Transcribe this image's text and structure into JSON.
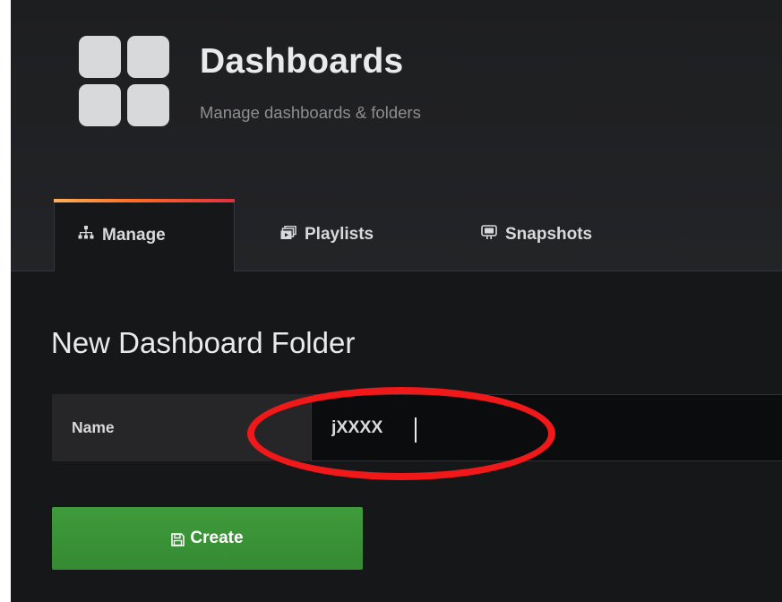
{
  "header": {
    "title": "Dashboards",
    "subtitle": "Manage dashboards & folders",
    "logo_icon": "dashboard-grid-icon"
  },
  "tabs": [
    {
      "label": "Manage",
      "icon": "sitemap-icon",
      "active": true
    },
    {
      "label": "Playlists",
      "icon": "playlist-icon",
      "active": false
    },
    {
      "label": "Snapshots",
      "icon": "snapshot-icon",
      "active": false
    }
  ],
  "page": {
    "heading": "New Dashboard Folder"
  },
  "form": {
    "name_label": "Name",
    "name_value": "jXXXX"
  },
  "actions": {
    "create_label": "Create",
    "create_icon": "save-icon"
  },
  "colors": {
    "background": "#161719",
    "header_bg": "#1f2023",
    "active_tab_accent": "#ff6b22",
    "create_button": "#3f9b3b",
    "annotation": "#f01818"
  }
}
